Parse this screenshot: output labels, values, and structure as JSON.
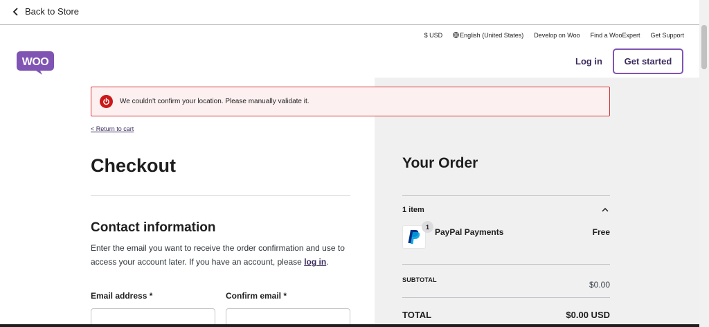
{
  "topbar": {
    "back_label": "Back to Store"
  },
  "utility_nav": {
    "currency": "$ USD",
    "language": "English (United States)",
    "develop": "Develop on Woo",
    "find_expert": "Find a WooExpert",
    "support": "Get Support"
  },
  "header": {
    "logo_text": "WOO",
    "login_label": "Log in",
    "get_started_label": "Get started"
  },
  "alert": {
    "message": "We couldn't confirm your location. Please manually validate it."
  },
  "checkout": {
    "return_link": "< Return to cart",
    "title": "Checkout",
    "contact_heading": "Contact information",
    "contact_text": "Enter the email you want to receive the order confirmation and use to access your account later. If you have an account, please",
    "contact_login_link": "log in",
    "contact_text_end": ".",
    "email_label": "Email address *",
    "confirm_email_label": "Confirm email *",
    "email_value": "",
    "confirm_email_value": ""
  },
  "order": {
    "title": "Your Order",
    "items_count": "1 item",
    "product_name": "PayPal Payments",
    "product_qty": "1",
    "product_price": "Free",
    "subtotal_label": "SUBTOTAL",
    "subtotal_value": "$0.00",
    "total_label": "TOTAL",
    "total_value": "$0.00 USD"
  },
  "colors": {
    "brand_purple": "#7f54b3",
    "dark_purple": "#3c2c5e",
    "error_red": "#cc1818",
    "panel_gray": "#f0f0f1"
  },
  "icons": [
    "chevron-left-icon",
    "globe-icon",
    "woo-logo",
    "error-icon",
    "chevron-up-icon",
    "paypal-icon"
  ]
}
